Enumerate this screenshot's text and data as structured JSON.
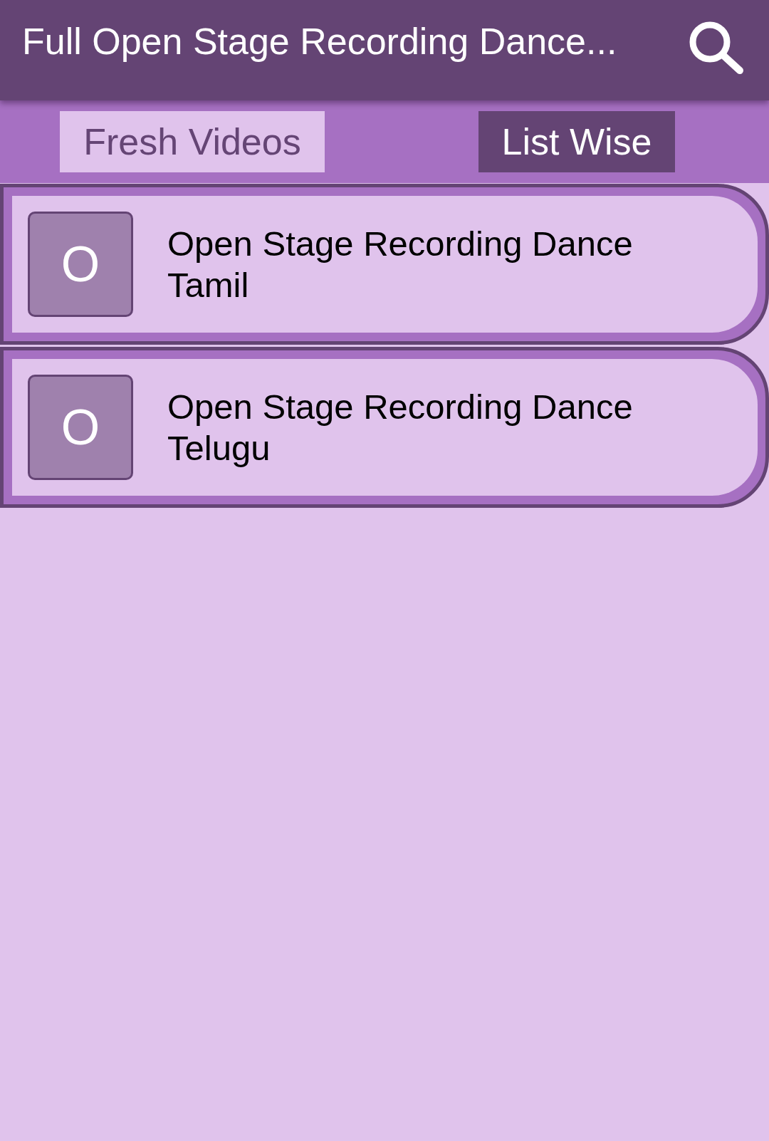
{
  "app_bar": {
    "title": "Full Open Stage Recording Dance..."
  },
  "tabs": [
    {
      "label": "Fresh Videos",
      "selected": false
    },
    {
      "label": "List Wise",
      "selected": true
    }
  ],
  "videos": [
    {
      "initial": "O",
      "title": "Open Stage Recording Dance Tamil"
    },
    {
      "initial": "O",
      "title": "Open Stage Recording Dance Telugu"
    }
  ]
}
